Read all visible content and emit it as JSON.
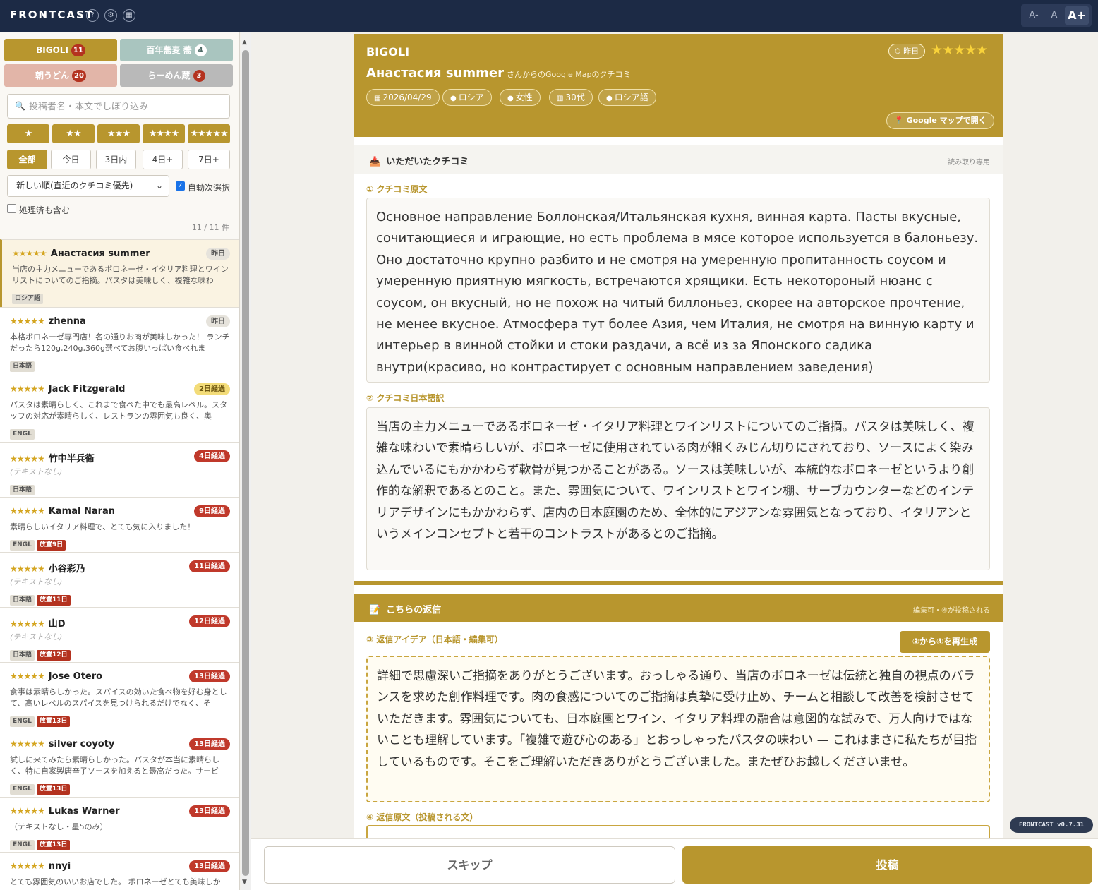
{
  "app": {
    "brand": "FRONTCAST",
    "version": "FRONTCAST v0.7.31"
  },
  "header_icons": [
    "help-icon",
    "settings-icon",
    "building-icon"
  ],
  "font_controls": {
    "small": "A-",
    "medium": "A",
    "large": "A+"
  },
  "store_tabs": [
    {
      "label": "BIGOLI",
      "count": "11"
    },
    {
      "label": "百年蕎麦 蕎",
      "count": "4"
    },
    {
      "label": "朝うどん",
      "count": "20"
    },
    {
      "label": "らーめん蔵",
      "count": "3"
    }
  ],
  "search": {
    "placeholder": "投稿者名・本文でしぼり込み"
  },
  "star_filters": [
    "★",
    "★★",
    "★★★",
    "★★★★",
    "★★★★★"
  ],
  "day_filters": [
    "全部",
    "今日",
    "3日内",
    "4日+",
    "7日+"
  ],
  "sort": {
    "selected": "新しい順(直近のクチコミ優先)"
  },
  "auto_next": {
    "label": "自動次選択",
    "checked": true
  },
  "include_done": {
    "label": "処理済も含む",
    "checked": false
  },
  "list_count": "11 / 11 件",
  "reviews": [
    {
      "stars": "★★★★★",
      "name": "Анастасия summer",
      "age": "昨日",
      "age_style": "grey",
      "body": "当店の主力メニューであるボロネーゼ・イタリア料理とワインリストについてのご指摘。パスタは美味しく、複雑な味わ",
      "tags": [
        "ロシア語"
      ],
      "flags": []
    },
    {
      "stars": "★★★★★",
      "name": "zhenna",
      "age": "昨日",
      "age_style": "grey",
      "body": "本格ボロネーゼ専門店！名の通りお肉が美味しかった！ ランチだったら120g,240g,360g選べてお腹いっぱい食べれま",
      "tags": [
        "日本語"
      ],
      "flags": []
    },
    {
      "stars": "★★★★★",
      "name": "Jack Fitzgerald",
      "age": "2日経過",
      "age_style": "yellow",
      "body": "パスタは素晴らしく、これまで食べた中でも最高レベル。スタッフの対応が素晴らしく、レストランの雰囲気も良く、奥",
      "tags": [
        "ENGL"
      ],
      "flags": []
    },
    {
      "stars": "★★★★★",
      "name": "竹中半兵衛",
      "age": "4日経過",
      "age_style": "red",
      "body": "(テキストなし)",
      "empty": true,
      "tags": [
        "日本語"
      ],
      "flags": []
    },
    {
      "stars": "★★★★★",
      "name": "Kamal Naran",
      "age": "9日経過",
      "age_style": "red",
      "body": "素晴らしいイタリア料理で、とても気に入りました！",
      "tags": [
        "ENGL"
      ],
      "flags": [
        "放置9日"
      ]
    },
    {
      "stars": "★★★★★",
      "name": "小谷彩乃",
      "age": "11日経過",
      "age_style": "red",
      "body": "(テキストなし)",
      "empty": true,
      "tags": [
        "日本語"
      ],
      "flags": [
        "放置11日"
      ]
    },
    {
      "stars": "★★★★★",
      "name": "山D",
      "age": "12日経過",
      "age_style": "red",
      "body": "(テキストなし)",
      "empty": true,
      "tags": [
        "日本語"
      ],
      "flags": [
        "放置12日"
      ]
    },
    {
      "stars": "★★★★★",
      "name": "Jose Otero",
      "age": "13日経過",
      "age_style": "red",
      "body": "食事は素晴らしかった。スパイスの効いた食べ物を好む身として、高いレベルのスパイスを見つけられるだけでなく、そ",
      "tags": [
        "ENGL"
      ],
      "flags": [
        "放置13日"
      ]
    },
    {
      "stars": "★★★★★",
      "name": "silver coyoty",
      "age": "13日経過",
      "age_style": "red",
      "body": "試しに来てみたら素晴らしかった。パスタが本当に素晴らしく、特に自家製唐辛子ソースを加えると最高だった。サービ",
      "tags": [
        "ENGL"
      ],
      "flags": [
        "放置13日"
      ]
    },
    {
      "stars": "★★★★★",
      "name": "Lukas Warner",
      "age": "13日経過",
      "age_style": "red",
      "body": "（テキストなし・星5のみ）",
      "tags": [
        "ENGL"
      ],
      "flags": [
        "放置13日"
      ]
    },
    {
      "stars": "★★★★★",
      "name": "nnyi",
      "age": "13日経過",
      "age_style": "red",
      "body": "とても雰囲気のいいお店でした。 ボロネーゼとても美味しか",
      "tags": [],
      "flags": []
    }
  ],
  "detail": {
    "store": "BIGOLI",
    "reviewer": "Анастасия summer",
    "reviewer_suffix": "さんからのGoogle Mapのクチコミ",
    "age": "昨日",
    "stars": "★★★★★",
    "chips": [
      {
        "icon": "calendar-icon",
        "label": "2026/04/29"
      },
      {
        "icon": "globe-icon",
        "label": "ロシア"
      },
      {
        "icon": "person-icon",
        "label": "女性"
      },
      {
        "icon": "cake-icon",
        "label": "30代"
      },
      {
        "icon": "speech-icon",
        "label": "ロシア語"
      }
    ],
    "gmap_button": "Google マップで開く",
    "received_section": {
      "title": "いただいたクチコミ",
      "note": "読み取り専用"
    },
    "original_label": "① クチコミ原文",
    "original_text": "Основное направление Боллонская/Итальянская кухня, винная карта. Пасты вкусные, сочитающиеся и играющие, но есть проблема в мясе которое используется в балоньезу. Оно достаточно крупно разбито и не смотря на умеренную пропитанность соусом и умеренную приятную мягкость, встречаются хрящики. Есть некотороный нюанс с соусом, он вкусный, но не похож на читый биллоньез, скорее на авторское прочтение, не менее вкусное. Атмосфера тут более Азия, чем Италия, не смотря на винную карту и интерьер в винной стойки и стоки раздачи, а всё из за Японского садика внутри(красиво, но контрастирует с основным направлением заведения)",
    "translation_label": "② クチコミ日本語訳",
    "translation_text": "当店の主力メニューであるボロネーゼ・イタリア料理とワインリストについてのご指摘。パスタは美味しく、複雑な味わいで素晴らしいが、ボロネーゼに使用されている肉が粗くみじん切りにされており、ソースによく染み込んでいるにもかかわらず軟骨が見つかることがある。ソースは美味しいが、本統的なボロネーゼというより創作的な解釈であるとのこと。また、雰囲気について、ワインリストとワイン棚、サーブカウンターなどのインテリアデザインにもかかわらず、店内の日本庭園のため、全体的にアジアンな雰囲気となっており、イタリアンというメインコンセプトと若干のコントラストがあるとのご指摘。",
    "reply_section": {
      "title": "こちらの返信",
      "note": "編集可・④が投稿される"
    },
    "idea_label": "③ 返信アイデア（日本語・編集可）",
    "regen_button": "③から④を再生成",
    "idea_text": "詳細で思慮深いご指摘をありがとうございます。おっしゃる通り、当店のボロネーゼは伝統と独自の視点のバランスを求めた創作料理です。肉の食感についてのご指摘は真摯に受け止め、チームと相談して改善を検討させていただきます。雰囲気についても、日本庭園とワイン、イタリア料理の融合は意図的な試みで、万人向けではないことも理解しています。「複雑で遊び心のある」とおっしゃったパスタの味わい — これはまさに私たちが目指しているものです。そこをご理解いただきありがとうございました。またぜひお越しくださいませ。",
    "final_label": "④ 返信原文（投稿される文）"
  },
  "actions": {
    "skip": "スキップ",
    "post": "投稿"
  },
  "colors": {
    "accent": "#b8962e",
    "topbar": "#1c2a45",
    "danger": "#b4321f"
  }
}
